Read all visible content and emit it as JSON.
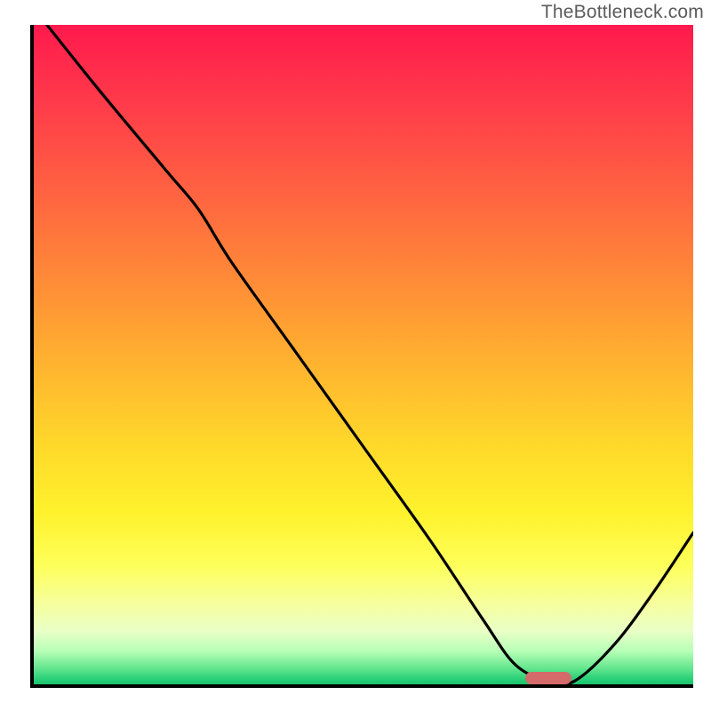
{
  "watermark": "TheBottleneck.com",
  "chart_data": {
    "type": "line",
    "title": "",
    "xlabel": "",
    "ylabel": "",
    "xlim": [
      0,
      100
    ],
    "ylim": [
      0,
      100
    ],
    "grid": false,
    "series": [
      {
        "name": "bottleneck-curve",
        "x": [
          2,
          10,
          20,
          25,
          30,
          40,
          50,
          60,
          68,
          73,
          78,
          82,
          88,
          94,
          100
        ],
        "values": [
          100,
          90,
          78,
          72,
          64,
          50,
          36,
          22,
          10,
          3,
          0.5,
          0.5,
          6,
          14,
          23
        ]
      }
    ],
    "optimum_marker": {
      "x": 78,
      "width_pct": 7
    },
    "colors": {
      "curve": "#000000",
      "marker": "#d46a6a",
      "gradient_top": "#ff1a4d",
      "gradient_bottom": "#18c36c"
    }
  }
}
